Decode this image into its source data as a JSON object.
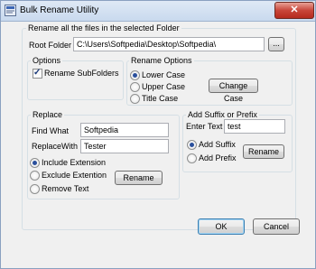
{
  "window": {
    "title": "Bulk Rename Utility",
    "close_glyph": "✕"
  },
  "main_group": {
    "label": "Rename all the files in the selected Folder"
  },
  "root_folder": {
    "label": "Root Folder",
    "value": "C:\\Users\\Softpedia\\Desktop\\Softpedia\\",
    "browse_label": "..."
  },
  "options": {
    "label": "Options",
    "rename_subfolders": {
      "label": "Rename SubFolders",
      "checked": true
    }
  },
  "rename_options": {
    "label": "Rename Options",
    "lower_case": "Lower Case",
    "upper_case": "Upper Case",
    "title_case": "Title Case",
    "selected": "Lower Case",
    "change_case_label": "Change Case"
  },
  "replace": {
    "label": "Replace",
    "find_label": "Find What",
    "find_value": "Softpedia",
    "replace_label": "ReplaceWith",
    "replace_value": "Tester",
    "include_extension": "Include Extension",
    "exclude_extension": "Exclude Extention",
    "remove_text": "Remove Text",
    "selected": "Include Extension",
    "rename_label": "Rename"
  },
  "suffix_prefix": {
    "label": "Add Suffix or Prefix",
    "enter_text_label": "Enter Text",
    "text_value": "test",
    "add_suffix": "Add Suffix",
    "add_prefix": "Add Prefix",
    "selected": "Add Suffix",
    "rename_label": "Rename"
  },
  "footer": {
    "ok_label": "OK",
    "cancel_label": "Cancel"
  }
}
